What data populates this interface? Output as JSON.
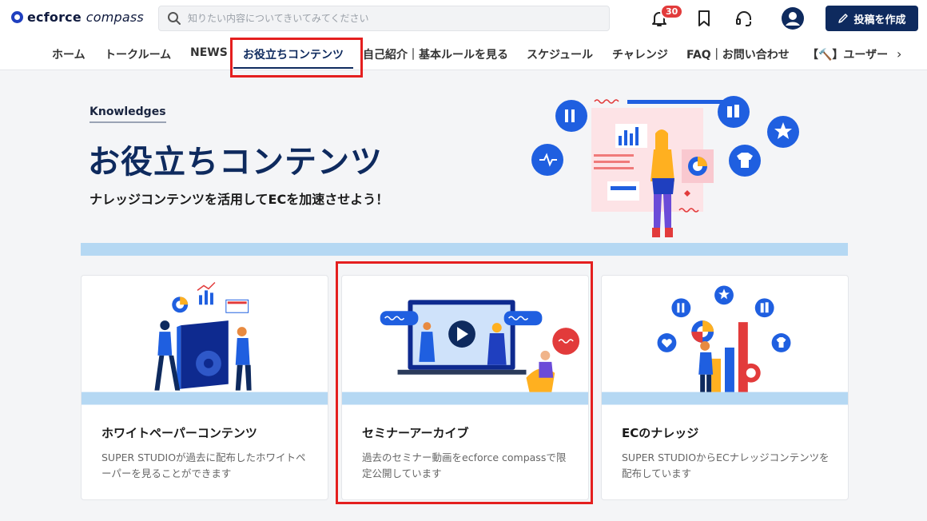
{
  "header": {
    "logo": {
      "bold": "ecforce",
      "light": "compass"
    },
    "search_placeholder": "知りたい内容についてきいてみてください",
    "notification_count": "30",
    "post_button": "投稿を作成"
  },
  "nav": {
    "items": [
      {
        "label": "ホーム"
      },
      {
        "label": "トークルーム"
      },
      {
        "label": "NEWS"
      },
      {
        "label": "お役立ちコンテンツ",
        "active": true
      },
      {
        "label": "自己紹介｜基本ルールを見る"
      },
      {
        "label": "スケジュール"
      },
      {
        "label": "チャレンジ"
      },
      {
        "label": "FAQ｜お問い合わせ"
      },
      {
        "label": "【🔨】ユーザー"
      }
    ]
  },
  "hero": {
    "label": "Knowledges",
    "title": "お役立ちコンテンツ",
    "subtitle": "ナレッジコンテンツを活用してECを加速させよう！"
  },
  "cards": [
    {
      "title": "ホワイトペーパーコンテンツ",
      "desc": "SUPER STUDIOが過去に配布したホワイトペーパーを見ることができます"
    },
    {
      "title": "セミナーアーカイブ",
      "desc": "過去のセミナー動画をecforce compassで限定公開しています"
    },
    {
      "title": "ECのナレッジ",
      "desc": "SUPER STUDIOからECナレッジコンテンツを配布しています"
    }
  ],
  "colors": {
    "brand": "#0e2a5e",
    "accent_blue": "#1f5fe0",
    "highlight_red": "#e41f1f",
    "band": "#b5d8f3"
  }
}
